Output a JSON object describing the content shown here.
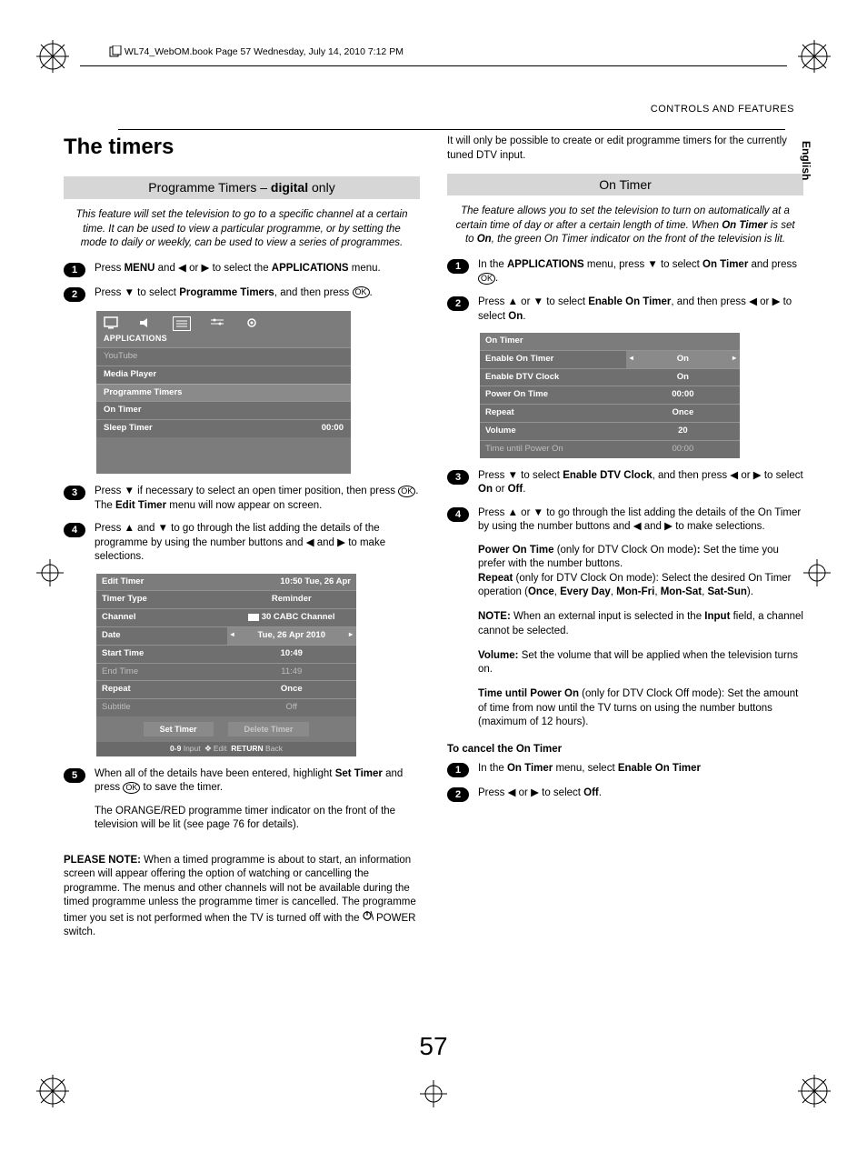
{
  "book_header": "WL74_WebOM.book  Page 57  Wednesday, July 14, 2010  7:12 PM",
  "running_head": "CONTROLS AND FEATURES",
  "lang_tab": "English",
  "page_number": "57",
  "left": {
    "title": "The timers",
    "section_bar": "Programme Timers – digital only",
    "section_bar_bold": "digital",
    "intro": "This feature will set the television to go to a specific channel at a certain time. It can be used to view a particular programme, or by setting the mode to daily or weekly, can be used to view a series of programmes.",
    "steps": {
      "s1": {
        "pre": "Press ",
        "b1": "MENU",
        "mid1": " and ",
        "mid2": " or ",
        "mid3": " to select the ",
        "b2": "APPLICATIONS",
        "post": " menu."
      },
      "s2": {
        "pre": "Press ",
        "mid": " to select ",
        "b1": "Programme Timers",
        "post": ", and then press "
      },
      "s3": {
        "pre": "Press ",
        "mid1": " if necessary to select an open timer position, then press ",
        "mid2": ". The ",
        "b1": "Edit Timer",
        "post": " menu will now appear on screen."
      },
      "s4": {
        "pre": "Press ",
        "mid1": " and ",
        "mid2": " to go through the list adding the details of the programme by using the number buttons and ",
        "mid3": " and ",
        "post": " to make selections."
      },
      "s5": {
        "pre": "When all of the details have been entered, highlight ",
        "b1": "Set Timer",
        "mid": " and press ",
        "post": " to save the timer."
      },
      "s5b": "The ORANGE/RED programme timer indicator on the front of the television will be lit (see page 76 for details)."
    },
    "menu1": {
      "title": "APPLICATIONS",
      "rows": [
        {
          "l": "YouTube",
          "dim": true
        },
        {
          "l": "Media Player"
        },
        {
          "l": "Programme Timers",
          "sel": true
        },
        {
          "l": "On Timer"
        },
        {
          "l": "Sleep Timer",
          "r": "00:00"
        }
      ]
    },
    "edit": {
      "title": "Edit Timer",
      "clock": "10:50 Tue, 26 Apr",
      "rows": [
        {
          "l": "Timer Type",
          "r": "Reminder"
        },
        {
          "l": "Channel",
          "r": "30 CABC Channel",
          "icon": true
        },
        {
          "l": "Date",
          "r": "Tue, 26 Apr 2010",
          "sel": true,
          "arrows": true
        },
        {
          "l": "Start Time",
          "r": "10:49"
        },
        {
          "l": "End Time",
          "r": "11:49",
          "dim": true
        },
        {
          "l": "Repeat",
          "r": "Once"
        },
        {
          "l": "Subtitle",
          "r": "Off",
          "dim": true
        }
      ],
      "btn_set": "Set Timer",
      "btn_del": "Delete Timer",
      "legend_09": "0-9",
      "legend_input": "Input",
      "legend_edit": "Edit",
      "legend_return": "RETURN",
      "legend_back": "Back"
    },
    "please_note_label": "PLEASE NOTE:",
    "please_note": " When a timed programme is about to start, an information screen will appear offering the option of watching or cancelling the programme. The menus and other channels will not be available during the timed programme unless the programme timer is cancelled. The programme timer you set is not performed when the TV is turned off with the ",
    "please_note_tail": " POWER switch."
  },
  "right": {
    "top_note": "It will only be possible to create or edit programme timers for the currently tuned DTV input.",
    "section_bar": "On Timer",
    "intro_pre": "The feature allows you to set the television to turn on automatically at a certain time of day or after a certain length of time. When ",
    "intro_b1": "On Timer",
    "intro_mid": " is set to ",
    "intro_b2": "On",
    "intro_post": ", the green On Timer indicator on the front of the television is lit.",
    "steps": {
      "s1": {
        "pre": "In the ",
        "b1": "APPLICATIONS",
        "mid": " menu, press ",
        "mid2": " to select ",
        "b2": "On Timer",
        "post": " and press "
      },
      "s2": {
        "pre": "Press ",
        "mid1": " or ",
        "mid2": " to select ",
        "b1": "Enable On Timer",
        "mid3": ", and then press ",
        "mid4": " or ",
        "mid5": " to select ",
        "b2": "On",
        "post": "."
      },
      "s3": {
        "pre": "Press ",
        "mid1": " to select ",
        "b1": "Enable DTV Clock",
        "mid2": ", and then press ",
        "mid3": " or ",
        "mid4": " to select ",
        "b2": "On",
        "mid5": " or ",
        "b3": "Off",
        "post": "."
      },
      "s4": {
        "pre": "Press ",
        "mid1": " or ",
        "mid2": " to go through the list adding the details of the On Timer by using the number buttons and ",
        "mid3": " and ",
        "post": " to make selections."
      }
    },
    "ontimer": {
      "title": "On Timer",
      "rows": [
        {
          "l": "Enable On Timer",
          "r": "On",
          "sel": true,
          "arrows": true
        },
        {
          "l": "Enable DTV Clock",
          "r": "On"
        },
        {
          "l": "Power On Time",
          "r": "00:00"
        },
        {
          "l": "Repeat",
          "r": "Once"
        },
        {
          "l": "Volume",
          "r": "20"
        },
        {
          "l": "Time until Power On",
          "r": "00:00",
          "dim": true
        }
      ]
    },
    "p1_b1": "Power On Time",
    "p1_t1": " (only for DTV Clock On mode)",
    "p1_b2": ":",
    "p1_t2": " Set the time you prefer with the number buttons.",
    "p2_b1": "Repeat",
    "p2_t1": " (only for DTV Clock On mode): Select the desired On Timer operation (",
    "p2_b2": "Once",
    "p2_c": ", ",
    "p2_b3": "Every Day",
    "p2_b4": "Mon-Fri",
    "p2_b5": "Mon-Sat",
    "p2_b6": "Sat-Sun",
    "p2_t2": ").",
    "note_b": "NOTE:",
    "note_t": " When an external input is selected in the ",
    "note_b2": "Input",
    "note_t2": " field, a channel cannot be selected.",
    "vol_b": "Volume:",
    "vol_t": " Set the volume that will be applied when the television turns on.",
    "tup_b": "Time until Power On",
    "tup_t": " (only for DTV Clock Off mode): Set the amount of time from now until the TV turns on using the number buttons (maximum of 12 hours).",
    "cancel_h": "To cancel the On Timer",
    "c1_pre": "In the ",
    "c1_b1": "On Timer",
    "c1_mid": " menu, select ",
    "c1_b2": "Enable On Timer",
    "c2_pre": "Press ",
    "c2_mid": " or ",
    "c2_mid2": " to select ",
    "c2_b": "Off",
    "c2_post": "."
  }
}
